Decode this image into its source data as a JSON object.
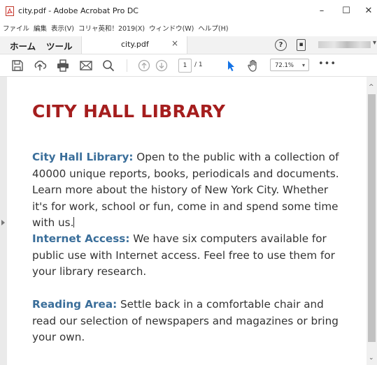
{
  "window": {
    "title": "city.pdf - Adobe Acrobat Pro DC",
    "minimize": "–",
    "maximize": "☐",
    "close": "✕"
  },
  "menu": {
    "items": [
      "ファイル",
      "編集",
      "表示(V)",
      "コリャ英和！2019(X)",
      "ウィンドウ(W)",
      "ヘルプ(H)"
    ]
  },
  "tabs": {
    "home": "ホーム",
    "tools": "ツール",
    "document": "city.pdf",
    "close_glyph": "×"
  },
  "toolbar": {
    "page_current": "1",
    "page_total": "/ 1",
    "zoom": "72.1%",
    "zoom_caret": "▾",
    "more": "•••"
  },
  "icons": [
    "save-icon",
    "upload-icon",
    "print-icon",
    "mail-icon",
    "search-icon",
    "prev-page-icon",
    "next-page-icon",
    "select-arrow-icon",
    "hand-tool-icon",
    "help-icon",
    "mobile-link-icon"
  ],
  "colors": {
    "title": "#a51e1e",
    "heading": "#3a6e9a",
    "body": "#333333",
    "select_tool": "#1473e6"
  },
  "document": {
    "title": "CITY HALL LIBRARY",
    "sections": [
      {
        "heading": "City Hall Library:",
        "text": " Open to the public with a collection of 40000 unique reports, books, periodicals and documents. Learn more about the history of New York City. Whether it's for work, school or fun, come in and spend some time with us."
      },
      {
        "heading": "Internet Access:",
        "text": " We have six computers available for public use with Internet access. Feel free to use them for your library research."
      },
      {
        "heading": "Reading Area:",
        "text": " Settle back in a comfortable chair and read our selection of newspapers and magazines or bring your own."
      }
    ]
  }
}
